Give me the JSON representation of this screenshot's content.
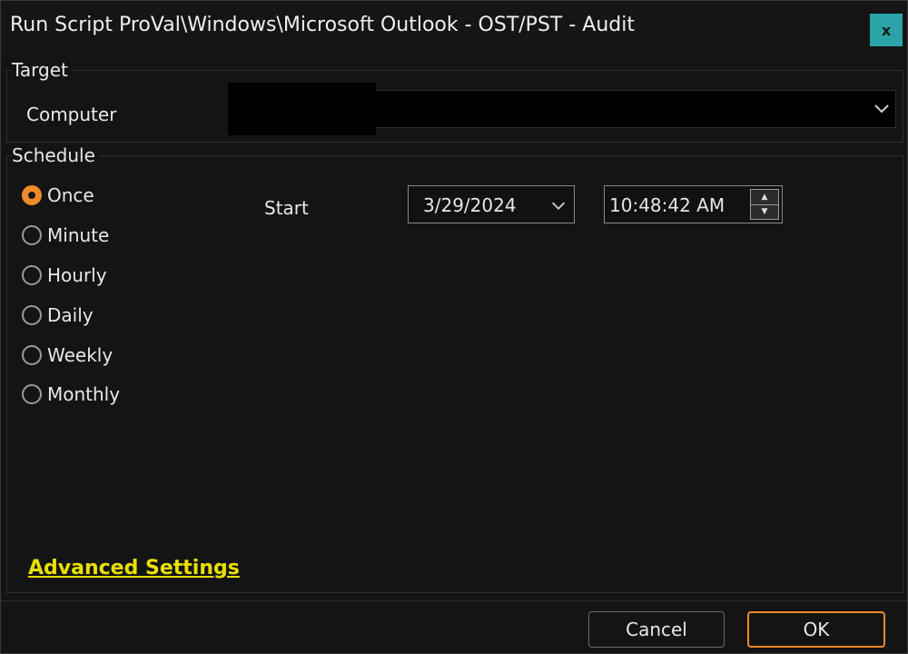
{
  "window": {
    "title": "Run Script ProVal\\Windows\\Microsoft Outlook - OST/PST - Audit",
    "close_label": "x"
  },
  "target": {
    "group_label": "Target",
    "computer_label": "Computer",
    "computer_value": ""
  },
  "schedule": {
    "group_label": "Schedule",
    "options": [
      "Once",
      "Minute",
      "Hourly",
      "Daily",
      "Weekly",
      "Monthly"
    ],
    "selected": "Once",
    "start_label": "Start",
    "date_value": "3/29/2024",
    "time_value": "10:48:42 AM"
  },
  "advanced_settings_label": "Advanced Settings",
  "buttons": {
    "cancel": "Cancel",
    "ok": "OK"
  },
  "colors": {
    "accent": "#f08a2a",
    "close_button": "#2aa3a8",
    "link": "#e8e000",
    "background": "#141414"
  }
}
